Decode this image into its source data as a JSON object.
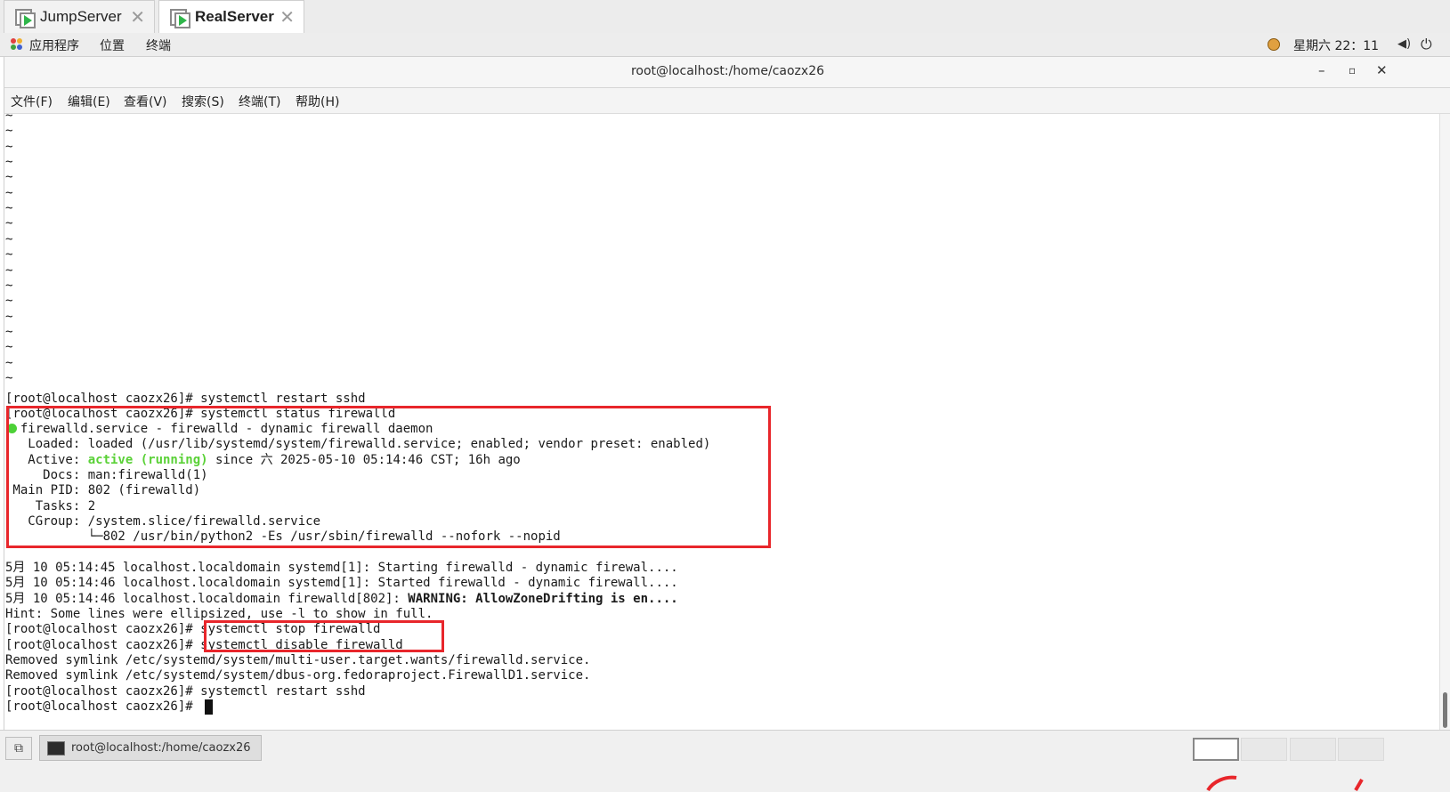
{
  "tabs": [
    {
      "label": "JumpServer",
      "active": false
    },
    {
      "label": "RealServer",
      "active": true
    }
  ],
  "panel": {
    "applications": "应用程序",
    "places": "位置",
    "terminal": "终端",
    "clock": "星期六 22：11"
  },
  "window": {
    "title": "root@localhost:/home/caozx26"
  },
  "menu": [
    "文件(F)",
    "编辑(E)",
    "查看(V)",
    "搜索(S)",
    "终端(T)",
    "帮助(H)"
  ],
  "terminal": {
    "tilde_count": 18,
    "lines": [
      "[root@localhost caozx26]# systemctl restart sshd",
      "[root@localhost caozx26]# systemctl status firewalld",
      "  firewalld.service - firewalld - dynamic firewall daemon",
      "   Loaded: loaded (/usr/lib/systemd/system/firewalld.service; enabled; vendor preset: enabled)",
      "   Active: ",
      "     Docs: man:firewalld(1)",
      " Main PID: 802 (firewalld)",
      "    Tasks: 2",
      "   CGroup: /system.slice/firewalld.service",
      "           └─802 /usr/bin/python2 -Es /usr/sbin/firewalld --nofork --nopid",
      "",
      "5月 10 05:14:45 localhost.localdomain systemd[1]: Starting firewalld - dynamic firewal....",
      "5月 10 05:14:46 localhost.localdomain systemd[1]: Started firewalld - dynamic firewall....",
      "5月 10 05:14:46 localhost.localdomain firewalld[802]: ",
      "Hint: Some lines were ellipsized, use -l to show in full.",
      "[root@localhost caozx26]# systemctl stop firewalld",
      "[root@localhost caozx26]# systemctl disable firewalld",
      "Removed symlink /etc/systemd/system/multi-user.target.wants/firewalld.service.",
      "Removed symlink /etc/systemd/system/dbus-org.fedoraproject.FirewallD1.service.",
      "[root@localhost caozx26]# systemctl restart sshd",
      "[root@localhost caozx26]# "
    ],
    "active_state": "active (running)",
    "active_rest": " since 六 2025-05-10 05:14:46 CST; 16h ago",
    "warning": "WARNING: AllowZoneDrifting is en...."
  },
  "taskbar": {
    "task_label": "root@localhost:/home/caozx26"
  },
  "colors": {
    "highlight": "#e8262b",
    "status_green": "#4cd137"
  }
}
